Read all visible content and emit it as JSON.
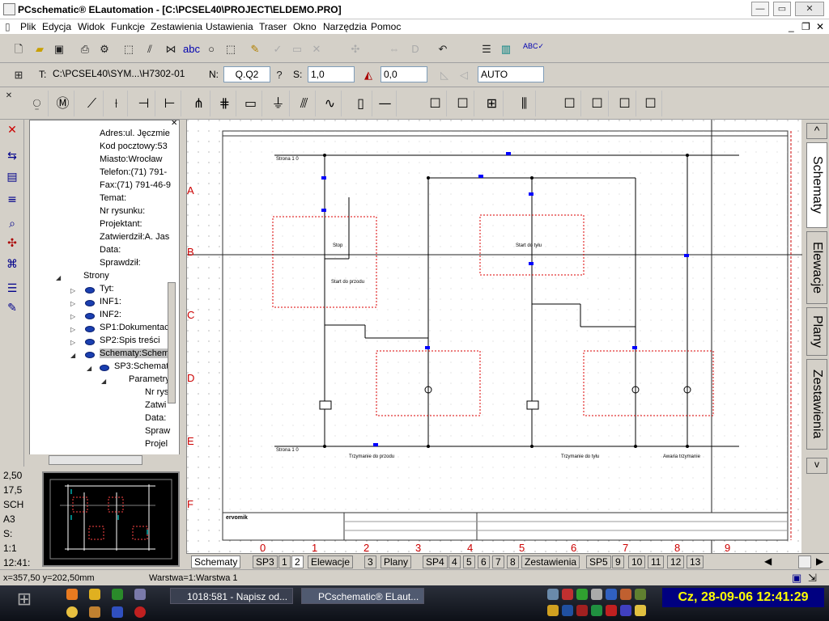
{
  "window": {
    "title": "PCschematic® ELautomation - [C:\\PCSEL40\\PROJECT\\ELDEMO.PRO]",
    "min_label": "—",
    "max_label": "▭",
    "close_label": "✕",
    "mdi_min": "_",
    "mdi_restore": "❐",
    "mdi_close": "✕"
  },
  "menu": [
    "Plik",
    "Edycja",
    "Widok",
    "Funkcje",
    "Zestawienia",
    "Ustawienia",
    "Traser",
    "Okno",
    "Narzędzia",
    "Pomoc"
  ],
  "toolbar2": {
    "t_label": "T:",
    "t_value": "C:\\PCSEL40\\SYM...\\H7302-01",
    "n_label": "N:",
    "n_value": "Q.Q2",
    "s_label": "S:",
    "s_value": "1,0",
    "angle_value": "0,0",
    "mode_value": "AUTO"
  },
  "tree": {
    "items": [
      "Adres:ul. Jęczmie",
      "Kod pocztowy:53",
      "Miasto:Wrocław",
      "Telefon:(71) 791-",
      "Fax:(71) 791-46-9",
      "Temat:",
      "Nr rysunku:",
      "Projektant:",
      "Zatwierdził:A. Jas",
      "Data:",
      "Sprawdził:",
      "Strony",
      "Tyt:",
      "INF1:",
      "INF2:",
      "SP1:Dokumentac",
      "SP2:Spis treści",
      "Schematy:Schem",
      "SP3:Schemat",
      "Parametry",
      "Nr rys",
      "Zatwi",
      "Data:",
      "Spraw",
      "Projel"
    ]
  },
  "left_values": [
    "2,50",
    "17,5",
    "SCH",
    "A3",
    "S:",
    "1:1",
    "12:41:"
  ],
  "drawing": {
    "rows": [
      "A",
      "B",
      "C",
      "D",
      "E",
      "F"
    ],
    "columns": [
      "0",
      "1",
      "2",
      "3",
      "4",
      "5",
      "6",
      "7",
      "8",
      "9"
    ],
    "labels": {
      "stop": "Stop",
      "start_front": "Start do przodu",
      "start_back": "Start do tyłu",
      "hold_front": "Trzymanie do przodu",
      "hold_back": "Trzymanie do tyłu",
      "emergency": "Awaria trzymanie",
      "strona": "Strona 1 0",
      "company": "ervomik"
    }
  },
  "right_tabs": [
    "Schematy",
    "Elewacje",
    "Plany",
    "Zestawienia"
  ],
  "right_tabs_arrows": {
    "up": "^",
    "down": "v"
  },
  "bottom_tabs": [
    "Schematy",
    "SP3",
    "1",
    "2",
    "Elewacje",
    "3",
    "Plany",
    "SP4",
    "4",
    "5",
    "6",
    "7",
    "8",
    "Zestawienia",
    "SP5",
    "9",
    "10",
    "11",
    "12",
    "13"
  ],
  "status": {
    "coords": "x=357,50 y=202,50mm",
    "layer": "Warstwa=1:Warstwa 1"
  },
  "taskbar": {
    "tasks": [
      "1018:581 - Napisz od...",
      "PCschematic® ELaut..."
    ],
    "clock": "Cz, 28-09-06 12:41:29"
  }
}
